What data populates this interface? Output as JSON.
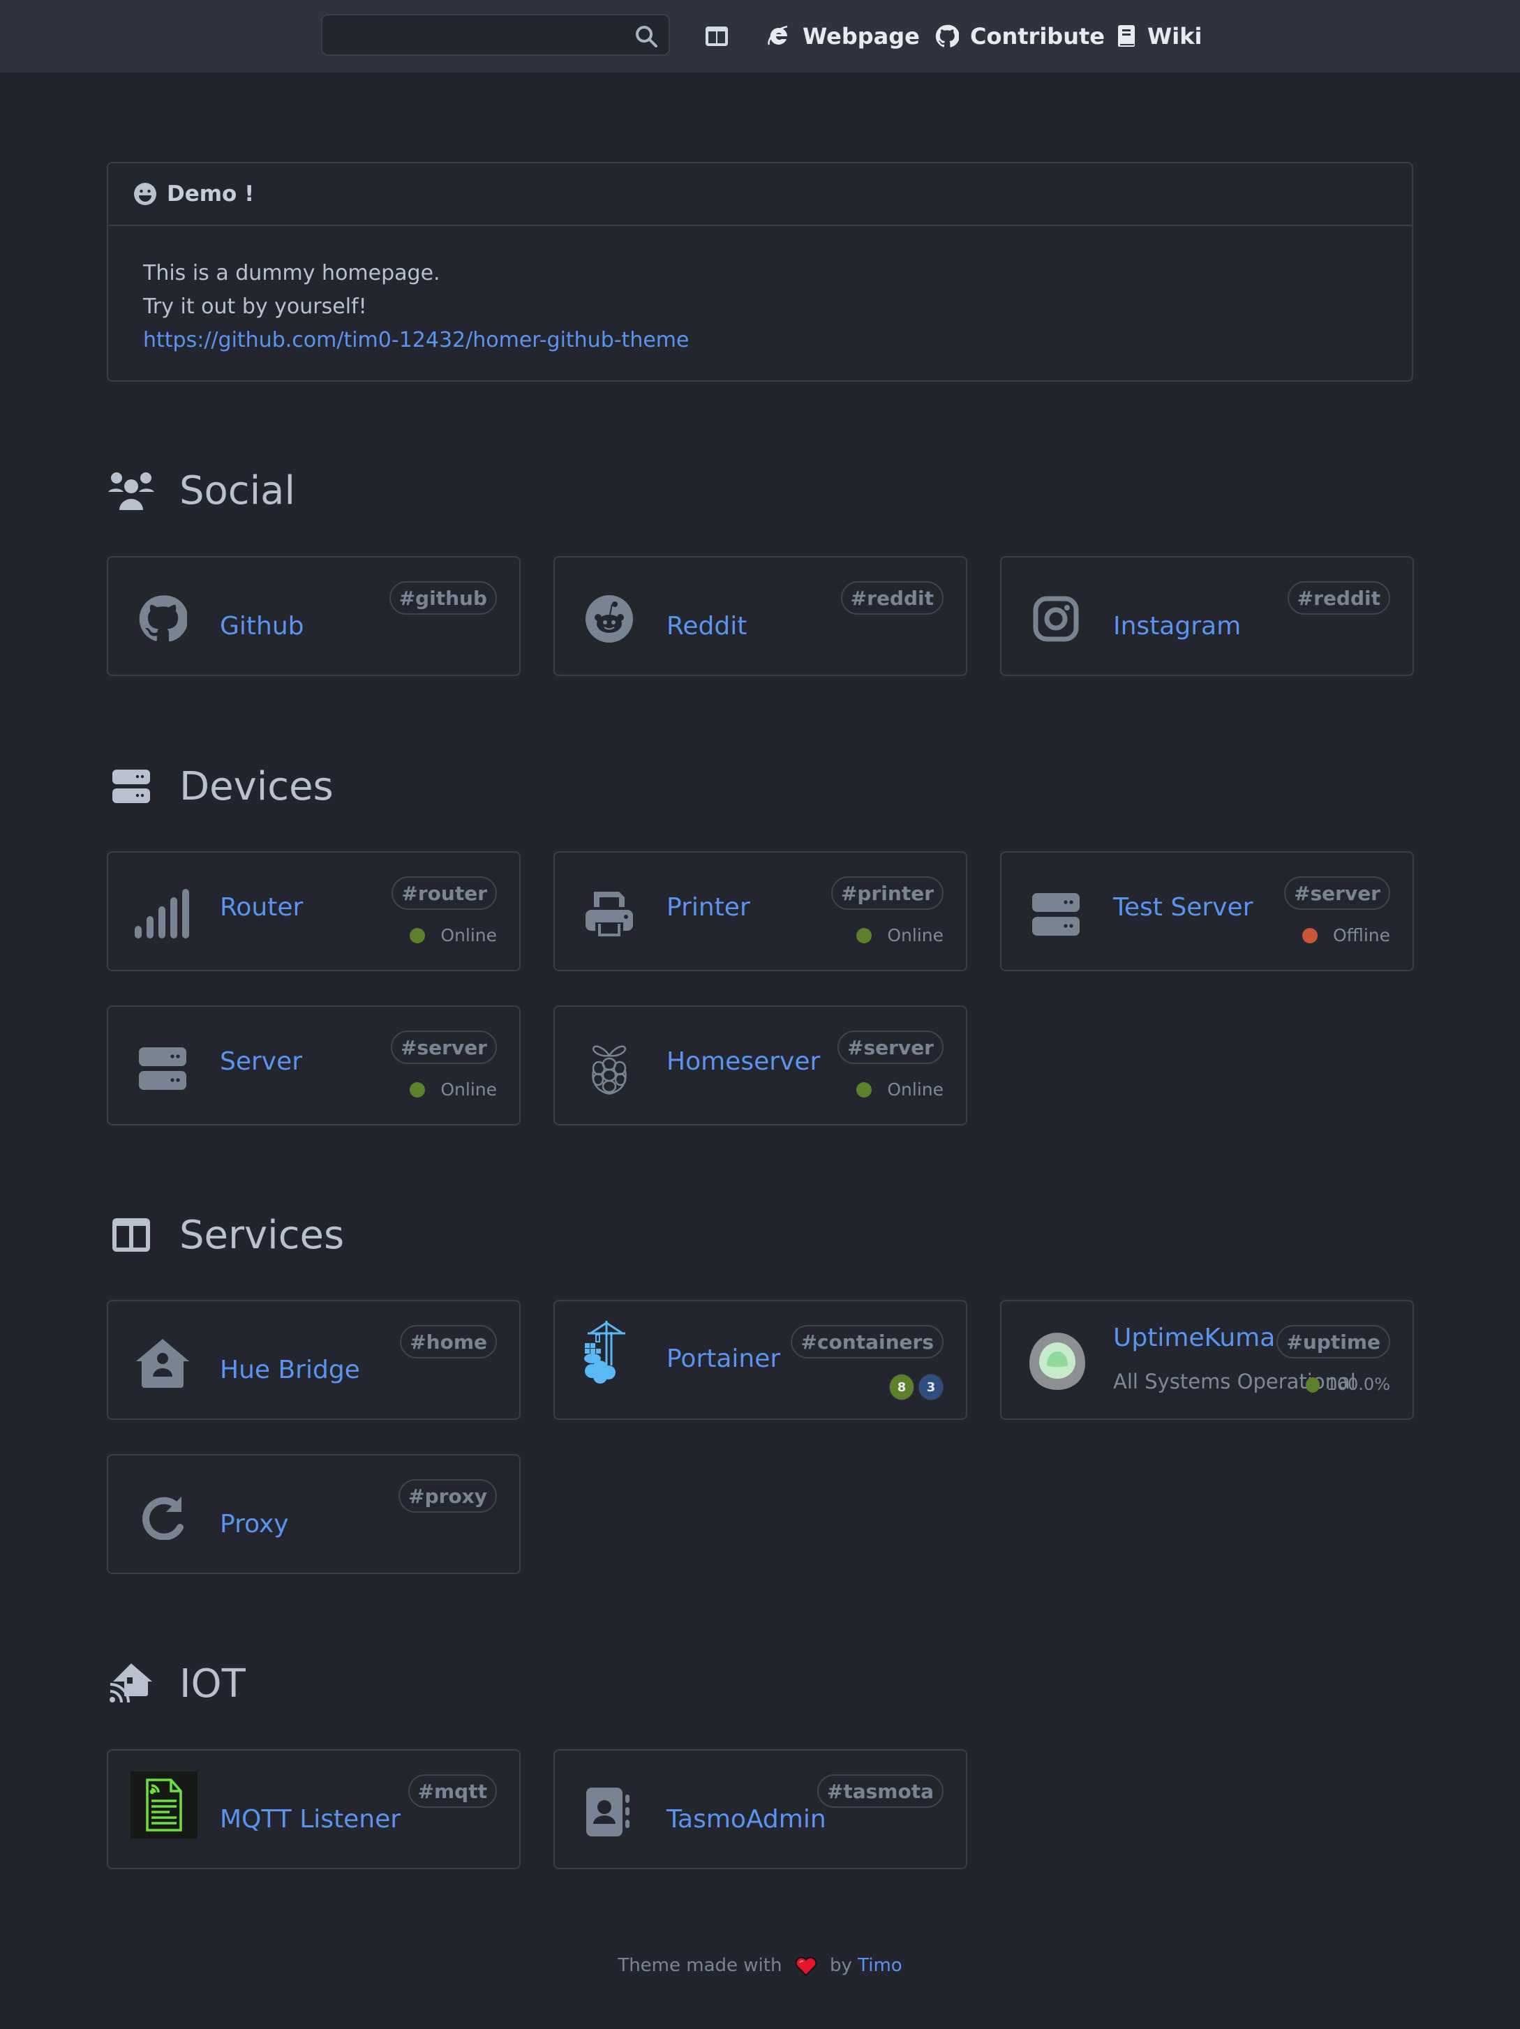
{
  "navbar": {
    "search": {
      "value": "",
      "placeholder": ""
    },
    "links": [
      {
        "label": "",
        "icon": "columns-icon"
      },
      {
        "label": "Webpage",
        "icon": "internet-explorer-icon"
      },
      {
        "label": "Contribute",
        "icon": "github-icon"
      },
      {
        "label": "Wiki",
        "icon": "book-icon"
      }
    ]
  },
  "message": {
    "title": "Demo !",
    "icon": "smile-icon",
    "lines": [
      "This is a dummy homepage.",
      "Try it out by yourself!"
    ],
    "link": "https://github.com/tim0-12432/homer-github-theme"
  },
  "groups": [
    {
      "title": "Social",
      "icon": "users-icon",
      "items": [
        {
          "name": "Github",
          "tag": "#github",
          "icon": "github-icon"
        },
        {
          "name": "Reddit",
          "tag": "#reddit",
          "icon": "reddit-icon"
        },
        {
          "name": "Instagram",
          "tag": "#reddit",
          "icon": "instagram-icon"
        }
      ]
    },
    {
      "title": "Devices",
      "icon": "server-icon",
      "items": [
        {
          "name": "Router",
          "tag": "#router",
          "icon": "signal-icon",
          "status": "Online"
        },
        {
          "name": "Printer",
          "tag": "#printer",
          "icon": "printer-icon",
          "status": "Online"
        },
        {
          "name": "Test Server",
          "tag": "#server",
          "icon": "server-icon",
          "status": "Offline"
        },
        {
          "name": "Server",
          "tag": "#server",
          "icon": "server-icon",
          "status": "Online"
        },
        {
          "name": "Homeserver",
          "tag": "#server",
          "icon": "raspberry-pi-icon",
          "status": "Online"
        }
      ]
    },
    {
      "title": "Services",
      "icon": "columns-icon",
      "items": [
        {
          "name": "Hue Bridge",
          "tag": "#home",
          "icon": "house-user-icon"
        },
        {
          "name": "Portainer",
          "tag": "#containers",
          "icon": "portainer-icon",
          "badges": [
            "8",
            "3"
          ]
        },
        {
          "name": "UptimeKuma",
          "tag": "#uptime",
          "icon": "uptime-kuma-icon",
          "subtitle": "All Systems Operational",
          "uptime": "100.0%"
        },
        {
          "name": "Proxy",
          "tag": "#proxy",
          "icon": "redo-icon"
        }
      ]
    },
    {
      "title": "IOT",
      "icon": "house-signal-icon",
      "items": [
        {
          "name": "MQTT Listener",
          "tag": "#mqtt",
          "icon": "mqtt-document-icon"
        },
        {
          "name": "TasmoAdmin",
          "tag": "#tasmota",
          "icon": "address-book-icon"
        }
      ]
    }
  ],
  "footer": {
    "prefix": "Theme made with",
    "middle": "by",
    "author": "Timo"
  },
  "colors": {
    "accent": "#5b94f0",
    "online": "#5d812a",
    "offline": "#c8563a",
    "background": "#22252e",
    "navbar": "#2f333d"
  }
}
